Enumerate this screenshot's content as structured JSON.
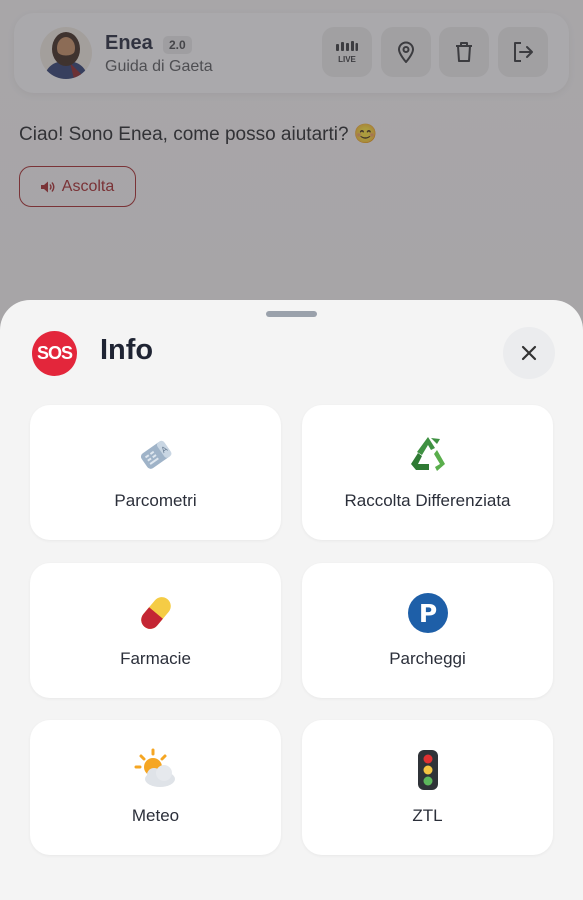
{
  "header": {
    "bot_name": "Enea",
    "version": "2.0",
    "subtitle": "Guida di Gaeta",
    "live_label": "LIVE",
    "icons": [
      "live-signal-icon",
      "map-pin-icon",
      "trash-icon",
      "logout-icon"
    ]
  },
  "chat": {
    "greeting": "Ciao! Sono Enea, come posso aiutarti? 😊",
    "listen_label": "Ascolta",
    "listen_icon": "speaker-icon"
  },
  "sheet": {
    "badge": "SOS",
    "title": "Info",
    "close_icon": "close-icon",
    "items": [
      {
        "label": "Parcometri",
        "icon": "parking-meter-ticket-icon"
      },
      {
        "label": "Raccolta Differenziata",
        "icon": "recycle-icon"
      },
      {
        "label": "Farmacie",
        "icon": "pill-icon"
      },
      {
        "label": "Parcheggi",
        "icon": "parking-icon"
      },
      {
        "label": "Meteo",
        "icon": "sun-cloud-icon"
      },
      {
        "label": "ZTL",
        "icon": "traffic-light-icon"
      }
    ]
  },
  "colors": {
    "accent_red": "#a52323",
    "sos_red": "#e3263b",
    "overlay": "#464850",
    "title": "#1f2433"
  }
}
